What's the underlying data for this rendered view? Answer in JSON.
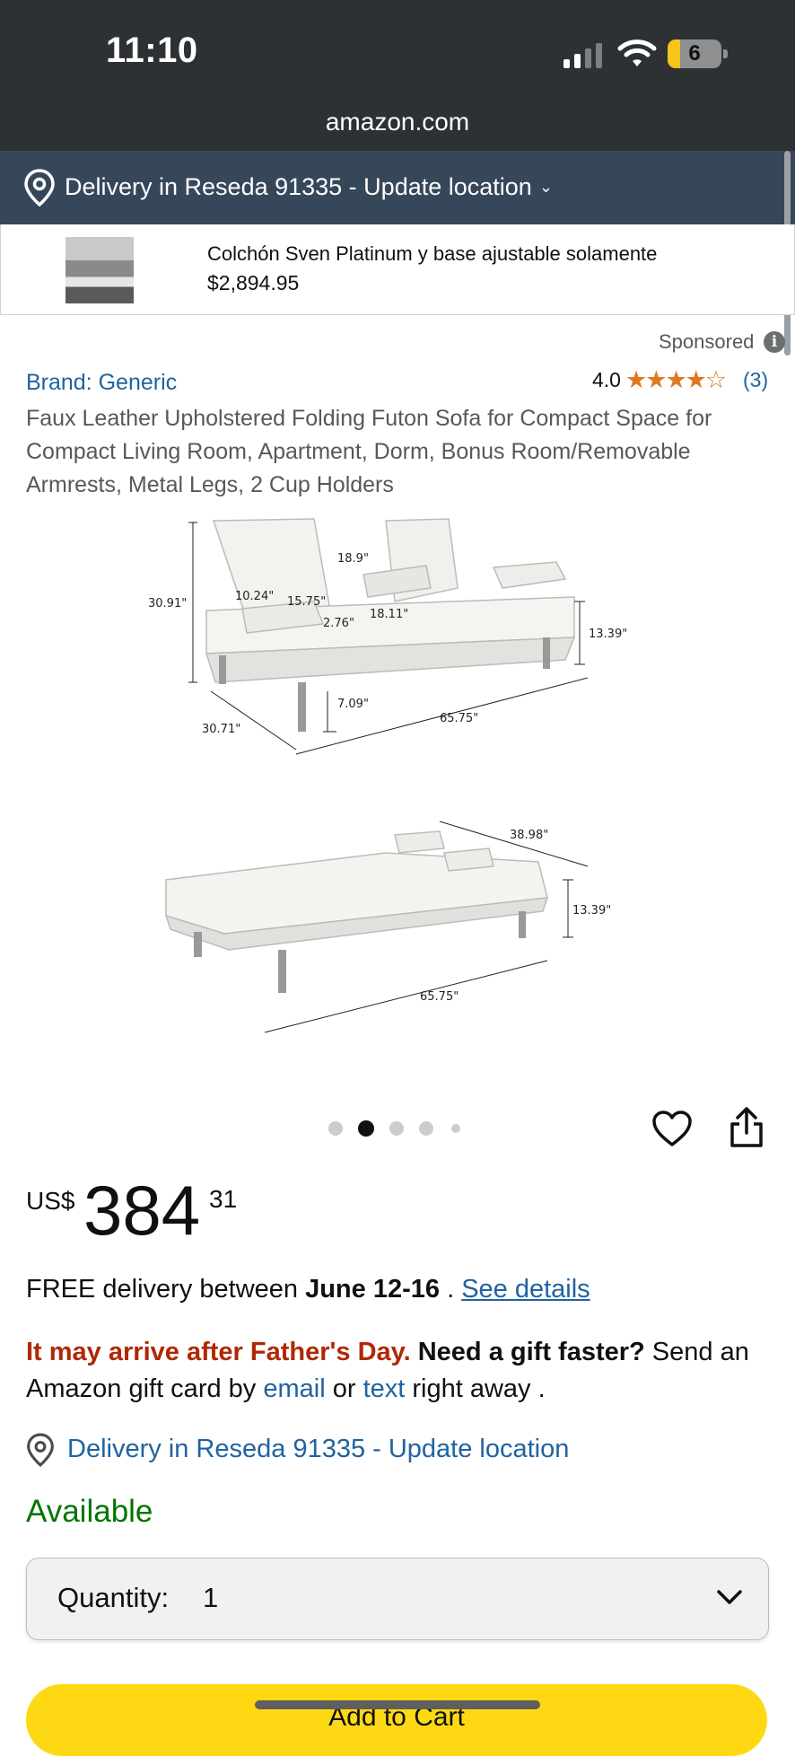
{
  "status_bar": {
    "time": "11:10",
    "battery": "6"
  },
  "browser": {
    "url": "amazon.com"
  },
  "delivery_bar": {
    "text": "Delivery in Reseda 91335 - Update location"
  },
  "ad_banner": {
    "title": "Colchón Sven Platinum y base ajustable solamente",
    "price": "$2,894.95"
  },
  "sponsored": {
    "label": "Sponsored",
    "info_icon": "i"
  },
  "product": {
    "brand": "Brand: Generic",
    "rating": "4.0",
    "rating_stars": 4,
    "reviews": "(3)",
    "title": "Faux Leather Upholstered Folding Futon Sofa for Compact Space for Compact Living Room, Apartment, Dorm, Bonus Room/Removable Armrests, Metal Legs, 2 Cup Holders"
  },
  "image_dimensions": {
    "height": "30.91\"",
    "depth": "30.71\"",
    "width": "65.75\"",
    "back_height": "18.9\"",
    "arm_width": "10.24\"",
    "arm_length": "15.75\"",
    "arm_height": "2.76\"",
    "seat_depth": "18.11\"",
    "seat_height": "13.39\"",
    "leg_height": "7.09\"",
    "bed_width": "38.98\"",
    "bed_height": "13.39\"",
    "bed_length": "65.75\""
  },
  "carousel": {
    "count": 5,
    "active": 1
  },
  "price": {
    "currency": "US$",
    "whole": "384",
    "fraction": "31"
  },
  "delivery": {
    "prefix": "FREE delivery between ",
    "dates": "June 12-16",
    "separator": " . ",
    "details_link": "See details"
  },
  "gift_notice": {
    "warning": "It may arrive after Father's Day.",
    "question": "Need a gift faster?",
    "text1": " Send an Amazon gift card by ",
    "email_link": "email",
    "text2": " or ",
    "text_link": "text",
    "text3": " right away ."
  },
  "location_link": "Delivery in Reseda 91335 - Update location",
  "availability": "Available",
  "quantity": {
    "label": "Quantity:",
    "value": "1"
  },
  "add_to_cart": "Add to Cart",
  "icons": [
    "location-pin-icon",
    "chevron-down-icon",
    "info-icon",
    "star-icon",
    "heart-icon",
    "share-icon",
    "signal-icon",
    "wifi-icon",
    "battery-icon"
  ],
  "colors": {
    "accent_blue": "#2162a1",
    "warning_red": "#b12704",
    "available_green": "#007600",
    "star_orange": "#de7921",
    "cart_yellow": "#ffd814",
    "nav_dark": "#37475a"
  }
}
